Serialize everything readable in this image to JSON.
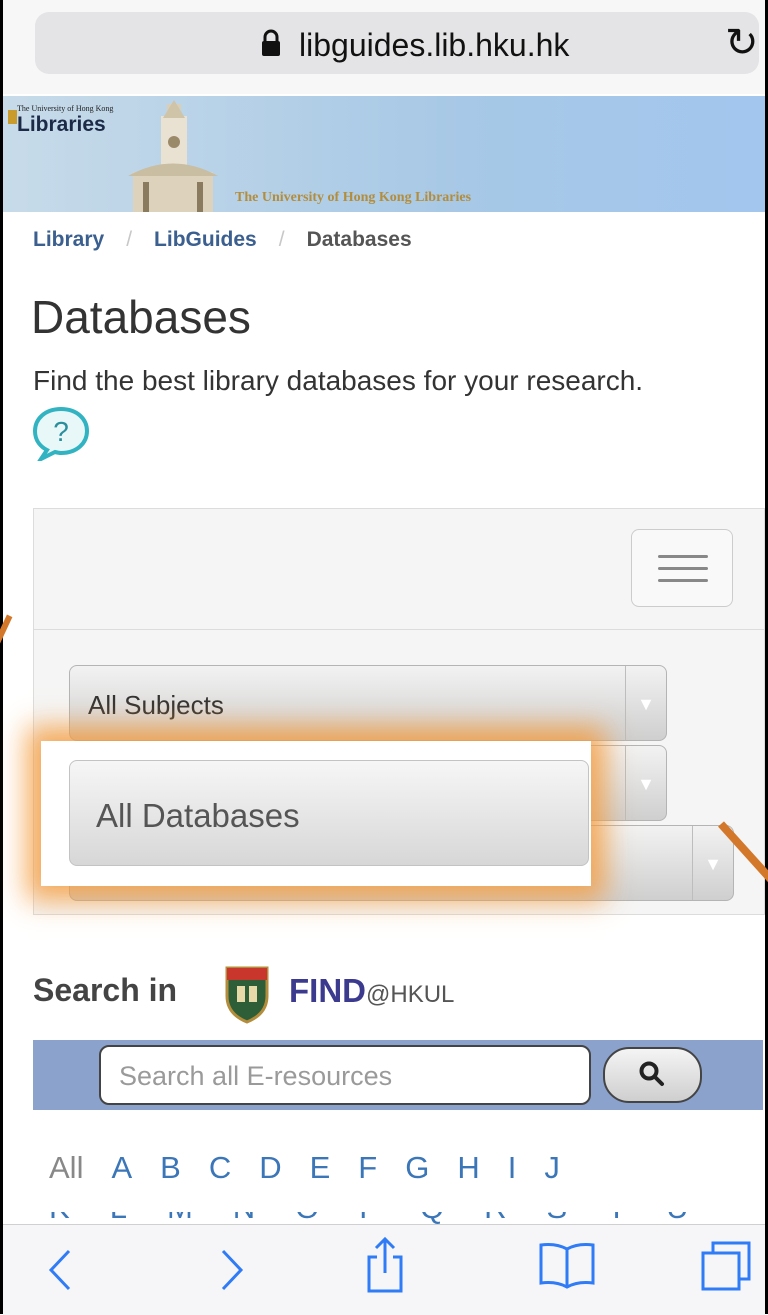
{
  "browser": {
    "url": "libguides.lib.hku.hk"
  },
  "banner": {
    "university_small": "The University of Hong Kong",
    "libraries": "Libraries",
    "tagline": "The University of Hong Kong Libraries"
  },
  "breadcrumb": {
    "items": [
      "Library",
      "LibGuides",
      "Databases"
    ],
    "separator": "/"
  },
  "page": {
    "title": "Databases",
    "subtitle": "Find the best library databases for your research."
  },
  "filters": {
    "subjects_value": "All Subjects",
    "databases_value": "All Databases"
  },
  "search_in": {
    "label": "Search in",
    "brand": "FIND",
    "brand_suffix": "@HKUL"
  },
  "search": {
    "placeholder": "Search all E-resources"
  },
  "az": {
    "row1": [
      "All",
      "A",
      "B",
      "C",
      "D",
      "E",
      "F",
      "G",
      "H",
      "I",
      "J"
    ],
    "row2": [
      "K",
      "L",
      "M",
      "N",
      "O",
      "P",
      "Q",
      "R",
      "S",
      "T",
      "U"
    ]
  },
  "colors": {
    "link": "#3b5f8f",
    "highlight": "#f59b3c",
    "search_bar": "#8aa2cc"
  },
  "icons": [
    "lock-icon",
    "reload-icon",
    "help-icon",
    "menu-icon",
    "chevron-down-icon",
    "search-icon",
    "back-icon",
    "forward-icon",
    "share-icon",
    "bookmarks-icon",
    "tabs-icon"
  ]
}
